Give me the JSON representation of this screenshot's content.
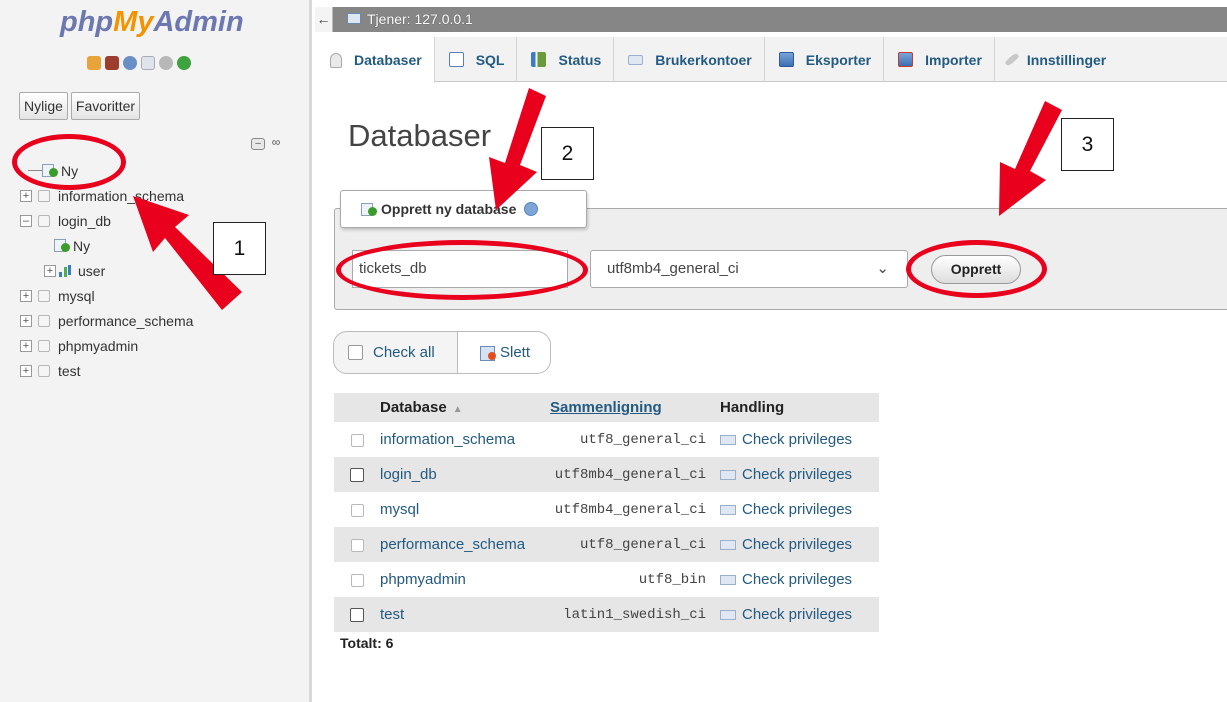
{
  "app": {
    "logo": {
      "php": "php",
      "my": "My",
      "admin": "Admin"
    },
    "server_label": "Tjener: 127.0.0.1",
    "back_glyph": "←"
  },
  "nav": {
    "tabs": [
      "Nylige",
      "Favoritter"
    ],
    "tree": {
      "new_item": "Ny",
      "databases": [
        {
          "name": "information_schema",
          "expanded": false
        },
        {
          "name": "login_db",
          "expanded": true,
          "children": [
            "Ny",
            "user"
          ]
        },
        {
          "name": "mysql",
          "expanded": false
        },
        {
          "name": "performance_schema",
          "expanded": false
        },
        {
          "name": "phpmyadmin",
          "expanded": false
        },
        {
          "name": "test",
          "expanded": false
        }
      ]
    }
  },
  "tabs": [
    {
      "label": "Databaser",
      "icon": "database-icon",
      "active": true
    },
    {
      "label": "SQL",
      "icon": "sql-icon"
    },
    {
      "label": "Status",
      "icon": "status-icon"
    },
    {
      "label": "Brukerkontoer",
      "icon": "user-accounts-icon"
    },
    {
      "label": "Eksporter",
      "icon": "export-icon"
    },
    {
      "label": "Importer",
      "icon": "import-icon"
    },
    {
      "label": "Innstillinger",
      "icon": "settings-icon"
    }
  ],
  "main": {
    "title": "Databaser",
    "create": {
      "legend": "Opprett ny database",
      "name_value": "tickets_db",
      "collation_value": "utf8mb4_general_ci",
      "submit_label": "Opprett"
    },
    "bulk": {
      "check_all": "Check all",
      "delete": "Slett"
    },
    "table": {
      "headers": {
        "database": "Database",
        "collation": "Sammenligning",
        "action": "Handling"
      },
      "rows": [
        {
          "name": "information_schema",
          "collation": "utf8_general_ci",
          "action": "Check privileges"
        },
        {
          "name": "login_db",
          "collation": "utf8mb4_general_ci",
          "action": "Check privileges"
        },
        {
          "name": "mysql",
          "collation": "utf8mb4_general_ci",
          "action": "Check privileges"
        },
        {
          "name": "performance_schema",
          "collation": "utf8_general_ci",
          "action": "Check privileges"
        },
        {
          "name": "phpmyadmin",
          "collation": "utf8_bin",
          "action": "Check privileges"
        },
        {
          "name": "test",
          "collation": "latin1_swedish_ci",
          "action": "Check privileges"
        }
      ],
      "total": "Totalt: 6"
    }
  },
  "annotations": {
    "labels": [
      "1",
      "2",
      "3"
    ],
    "color": "#e8001c"
  },
  "colors": {
    "link": "#235a81",
    "logo_blue": "#6c78af",
    "logo_orange": "#f29400"
  }
}
